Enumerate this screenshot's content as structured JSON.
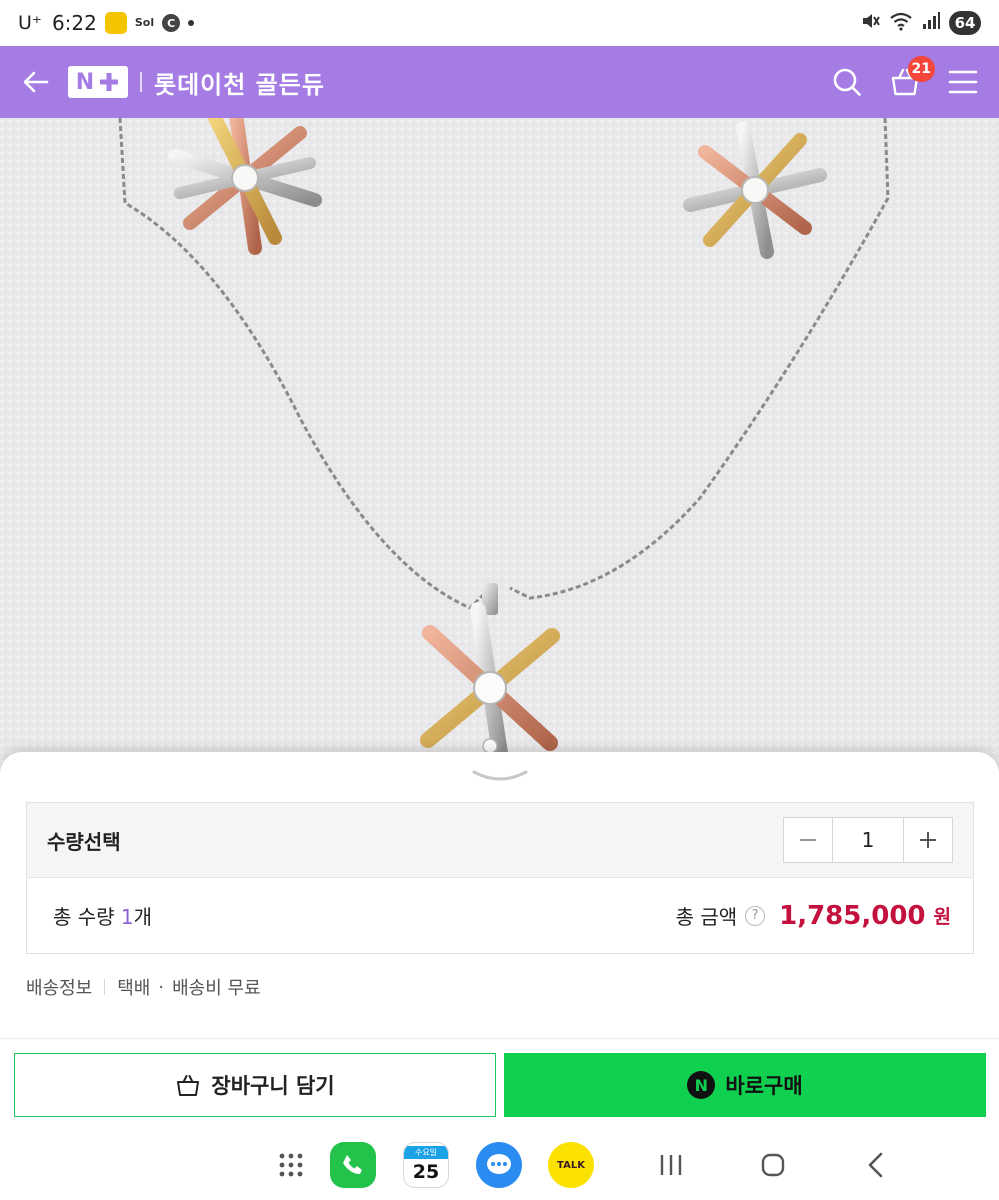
{
  "status_bar": {
    "carrier": "U⁺",
    "time": "6:22",
    "sol_label": "Sol",
    "c_label": "C",
    "battery": "64"
  },
  "header": {
    "logo_text": "N",
    "store_name": "롯데이천 골든듀",
    "cart_count": "21"
  },
  "option": {
    "quantity_label": "수량선택",
    "quantity_value": "1",
    "total_qty_prefix": "총 수량 ",
    "total_qty_value": "1",
    "total_qty_suffix": "개",
    "total_amount_label": "총 금액",
    "help_mark": "?",
    "total_amount": "1,785,000",
    "currency": "원"
  },
  "shipping": {
    "label": "배송정보",
    "method": "택배",
    "fee": "배송비 무료"
  },
  "actions": {
    "cart_label": "장바구니 담기",
    "buy_label": "바로구매",
    "npay_mark": "N"
  },
  "nav": {
    "calendar_day_label": "수요일",
    "calendar_date": "25",
    "kakao_label": "TALK"
  },
  "colors": {
    "header_purple": "#a47ce3",
    "price_red": "#c3103d",
    "buy_green": "#0fd14f"
  }
}
